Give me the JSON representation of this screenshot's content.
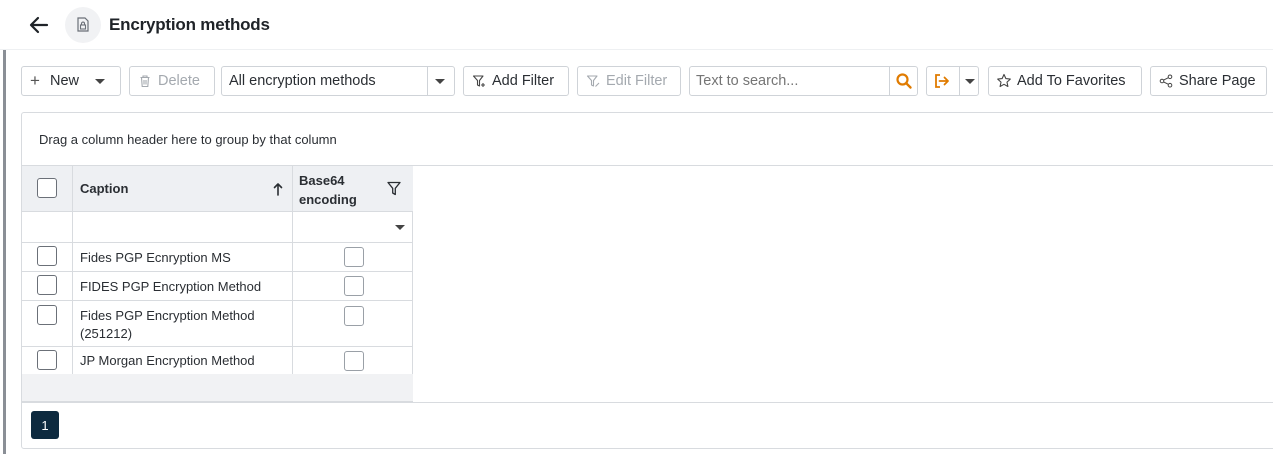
{
  "header": {
    "title": "Encryption methods",
    "back_icon": "arrow-left-icon",
    "page_icon": "lock-document-icon"
  },
  "toolbar": {
    "new_label": "New",
    "delete_label": "Delete",
    "view_selector_value": "All encryption methods",
    "add_filter_label": "Add Filter",
    "edit_filter_label": "Edit Filter",
    "search_placeholder": "Text to search...",
    "add_favorites_label": "Add To Favorites",
    "share_label": "Share Page",
    "accent_color": "#e07b00"
  },
  "grid": {
    "group_hint": "Drag a column header here to group by that column",
    "columns": [
      {
        "label": "Caption",
        "sort": "ascending"
      },
      {
        "label": "Base64 encoding",
        "filter_icon": "filter-icon"
      }
    ],
    "rows": [
      {
        "caption": "Fides PGP Ecnryption MS",
        "base64": false
      },
      {
        "caption": "FIDES PGP Encryption Method",
        "base64": false
      },
      {
        "caption": "Fides PGP Encryption Method (251212)",
        "base64": false
      },
      {
        "caption": "JP Morgan Encryption Method",
        "base64": false
      }
    ]
  },
  "pager": {
    "current_page": "1"
  }
}
